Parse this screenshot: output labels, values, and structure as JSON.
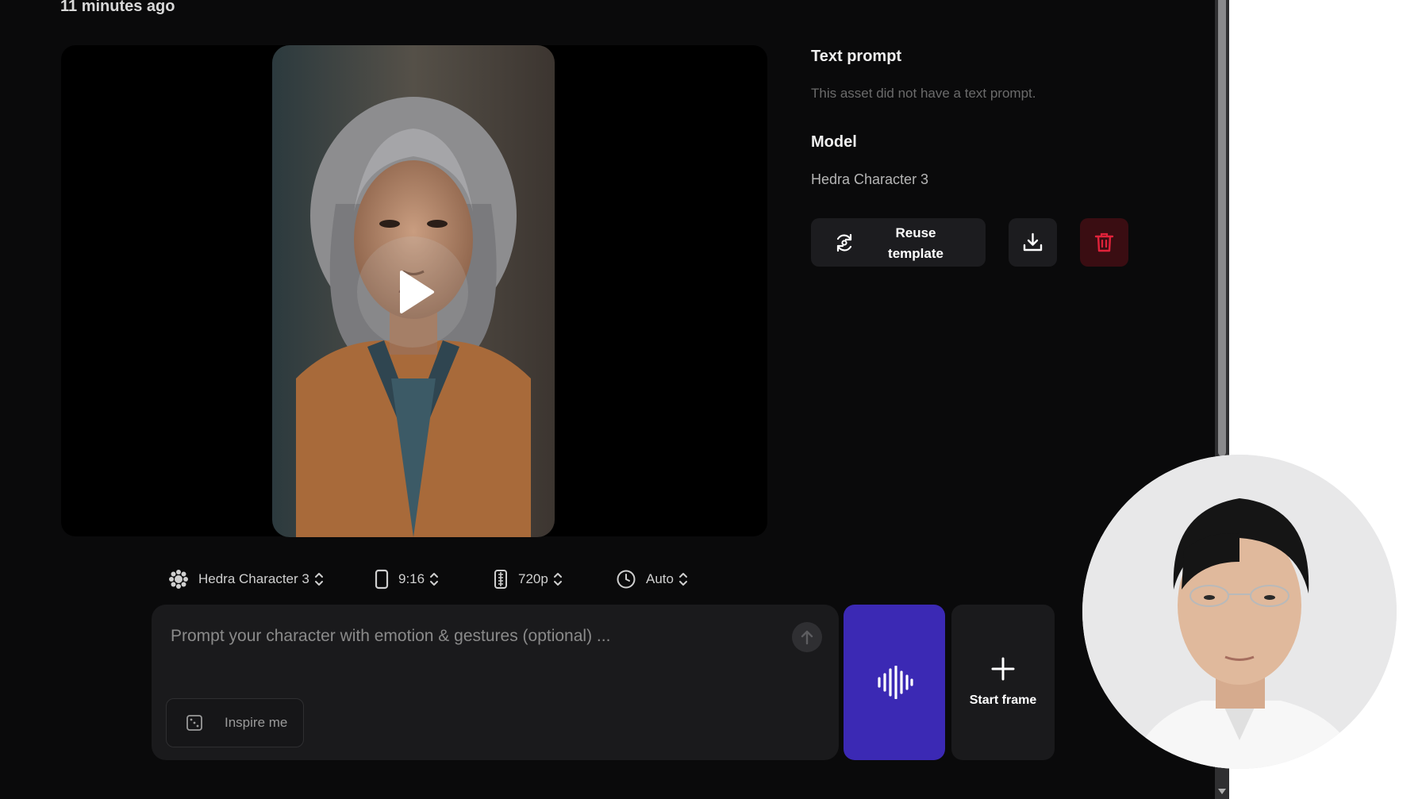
{
  "header": {
    "timestamp": "11 minutes ago"
  },
  "details": {
    "text_prompt_heading": "Text prompt",
    "text_prompt_value": "This asset did not have a text prompt.",
    "model_heading": "Model",
    "model_value": "Hedra Character 3"
  },
  "actions": {
    "reuse_label_line1": "Reuse",
    "reuse_label_line2": "template"
  },
  "options": {
    "model": "Hedra Character 3",
    "aspect_ratio": "9:16",
    "resolution": "720p",
    "duration": "Auto"
  },
  "composer": {
    "prompt_placeholder": "Prompt your character with emotion & gestures (optional) ...",
    "inspire_label": "Inspire me",
    "start_frame_label": "Start frame"
  },
  "colors": {
    "accent": "#3b29b4",
    "danger": "#e0223a",
    "background": "#0a0a0b"
  },
  "icons": [
    "play-icon",
    "reuse-icon",
    "download-icon",
    "trash-icon",
    "model-icon",
    "aspect-ratio-icon",
    "resolution-icon",
    "clock-icon",
    "chevron-updown-icon",
    "send-arrow-icon",
    "dice-icon",
    "audio-waveform-icon",
    "plus-icon"
  ]
}
